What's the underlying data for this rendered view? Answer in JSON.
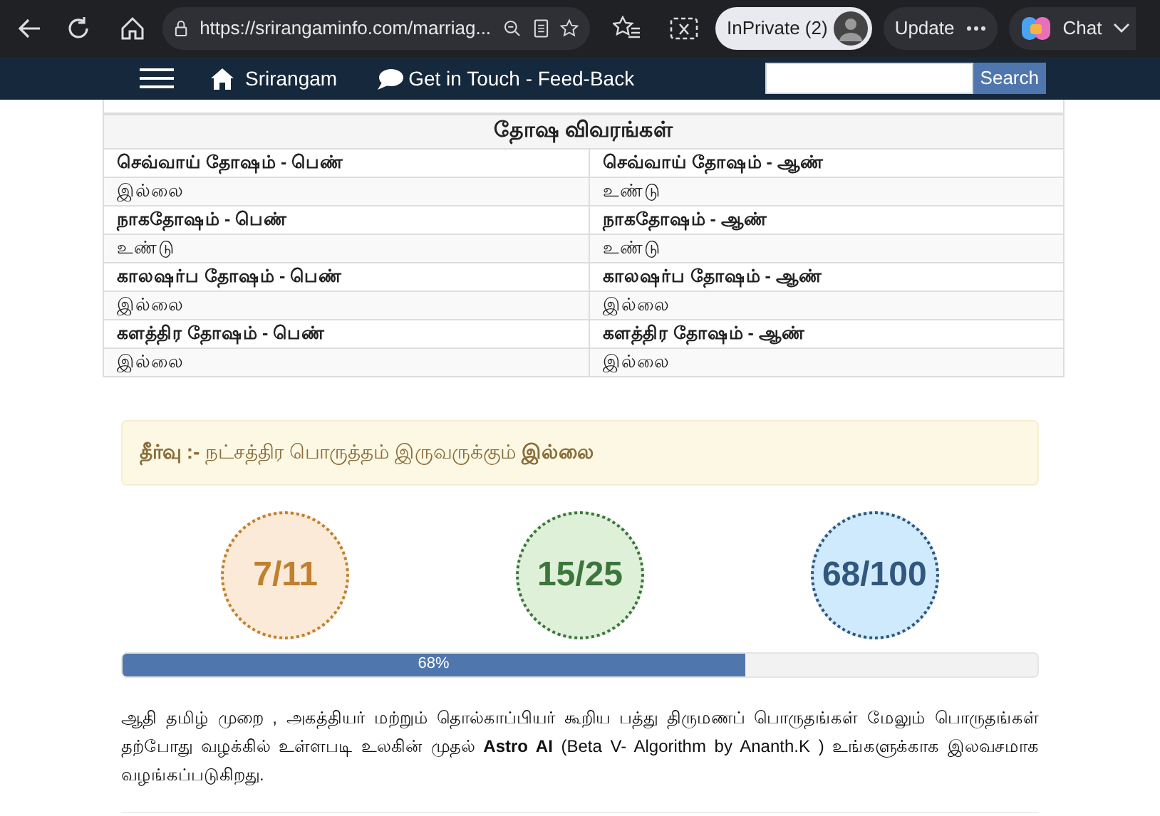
{
  "browser": {
    "url": "https://srirangaminfo.com/marriag...",
    "inprivate": "InPrivate (2)",
    "update": "Update",
    "chat": "Chat"
  },
  "navbar": {
    "brand": "Srirangam",
    "feedback": "Get in Touch - Feed-Back",
    "search_button": "Search"
  },
  "dosham_table": {
    "title": "தோஷ விவரங்கள்",
    "rows": [
      {
        "kind": "label",
        "cells": [
          "செவ்வாய் தோஷம் - பெண்",
          "செவ்வாய் தோஷம் - ஆண்"
        ]
      },
      {
        "kind": "value",
        "cells": [
          "இல்லை",
          "உண்டு"
        ]
      },
      {
        "kind": "label",
        "cells": [
          "நாகதோஷம் - பெண்",
          "நாகதோஷம் - ஆண்"
        ]
      },
      {
        "kind": "value",
        "cells": [
          "உண்டு",
          "உண்டு"
        ]
      },
      {
        "kind": "label",
        "cells": [
          "காலஷர்ப தோஷம் - பெண்",
          "காலஷர்ப தோஷம் - ஆண்"
        ]
      },
      {
        "kind": "value",
        "cells": [
          "இல்லை",
          "இல்லை"
        ]
      },
      {
        "kind": "label",
        "cells": [
          "களத்திர தோஷம் - பெண்",
          "களத்திர தோஷம் - ஆண்"
        ]
      },
      {
        "kind": "value",
        "cells": [
          "இல்லை",
          "இல்லை"
        ]
      }
    ]
  },
  "verdict": "**தீர்வு :-** நட்சத்திர பொருத்தம் இருவருக்கும் **இல்லை**",
  "scores": [
    {
      "text": "7/11",
      "color": "#c0802f"
    },
    {
      "text": "15/25",
      "color": "#3c763d"
    },
    {
      "text": "68/100",
      "color": "#31577e"
    }
  ],
  "progress": {
    "level": 0.68,
    "label": "68%"
  },
  "description": "ஆதி தமிழ் முறை , அகத்தியர் மற்றும் தொல்காப்பியர் கூறிய பத்து திருமணப் பொருதங்கள் மேலும் பொருதங்கள் தற்போது வழக்கில் உள்ளபடி உலகின் முதல் **Astro AI** (Beta V- Algorithm by Ananth.K ) உங்களுக்காக இலவசமாக வழங்கப்படுகிறது."
}
